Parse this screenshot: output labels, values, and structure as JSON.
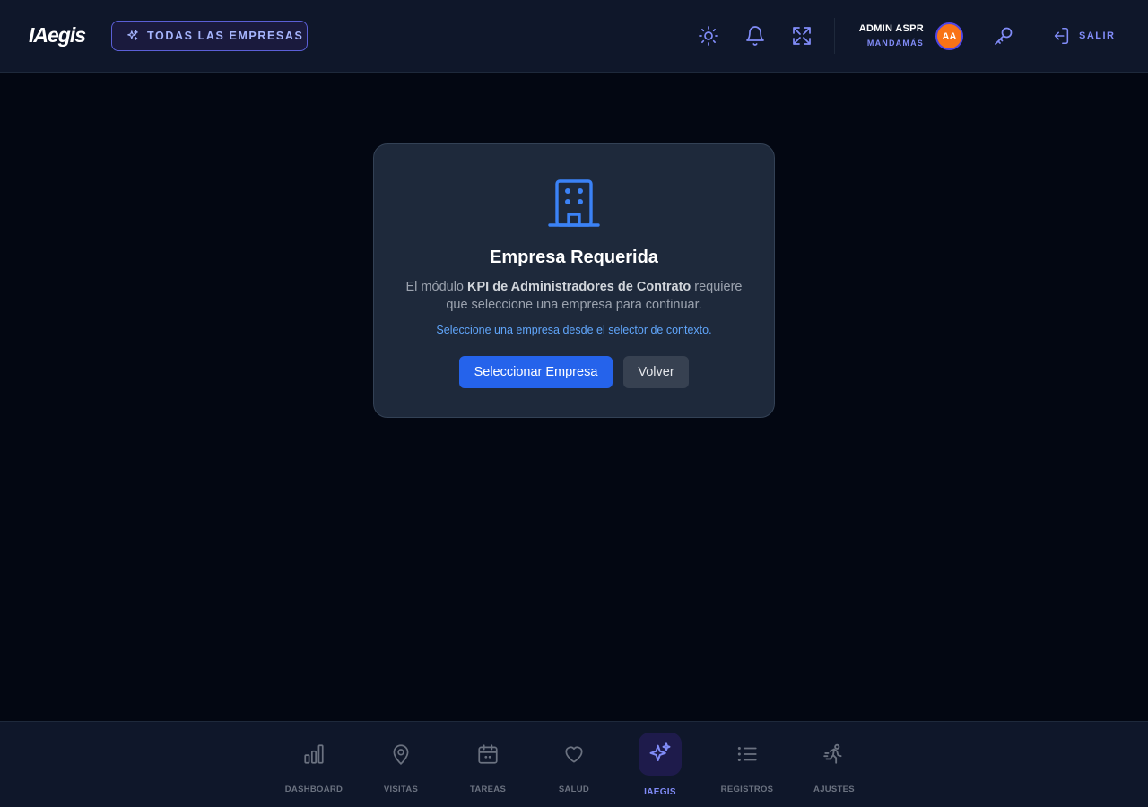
{
  "header": {
    "logo": "IAegis",
    "company_selector_label": "TODAS LAS EMPRESAS",
    "user_name": "ADMIN ASPR",
    "user_role": "MANDAMÁS",
    "avatar_initials": "AA",
    "logout_label": "SALIR",
    "icons": [
      "sparkles-icon",
      "sun-icon",
      "bell-icon",
      "expand-icon",
      "key-icon",
      "logout-icon"
    ]
  },
  "card": {
    "icon": "building-icon",
    "title": "Empresa Requerida",
    "desc_prefix": "El módulo ",
    "desc_module": "KPI de Administradores de Contrato",
    "desc_suffix": " requiere que seleccione una empresa para continuar.",
    "hint": "Seleccione una empresa desde el selector de contexto.",
    "primary_button": "Seleccionar Empresa",
    "secondary_button": "Volver"
  },
  "bottom_nav": {
    "items": [
      {
        "label": "DASHBOARD",
        "icon": "bar-chart-icon",
        "active": false
      },
      {
        "label": "VISITAS",
        "icon": "map-pin-icon",
        "active": false
      },
      {
        "label": "TAREAS",
        "icon": "calendar-icon",
        "active": false
      },
      {
        "label": "SALUD",
        "icon": "heart-icon",
        "active": false
      },
      {
        "label": "IAEGIS",
        "icon": "sparkles-icon",
        "active": true
      },
      {
        "label": "REGISTROS",
        "icon": "list-icon",
        "active": false
      },
      {
        "label": "AJUSTES",
        "icon": "runner-icon",
        "active": false
      }
    ]
  },
  "colors": {
    "background": "#030712",
    "header_bg": "#0f172a",
    "accent": "#818cf8",
    "primary": "#2563eb",
    "avatar": "#f97316"
  }
}
